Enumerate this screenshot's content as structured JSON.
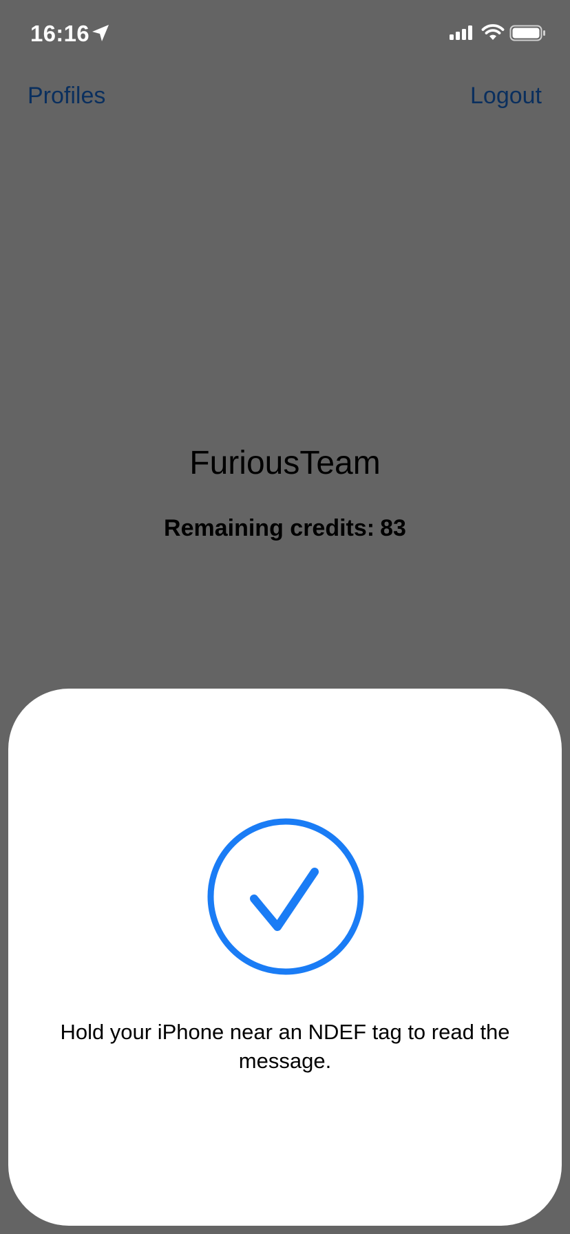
{
  "status_bar": {
    "time": "16:16",
    "icons": [
      "location-arrow-icon",
      "cellular-signal-icon",
      "wifi-icon",
      "battery-icon"
    ]
  },
  "nav": {
    "left_label": "Profiles",
    "right_label": "Logout"
  },
  "main": {
    "team_name": "FuriousTeam",
    "credits_label": "Remaining credits:",
    "credits_value": "83"
  },
  "nfc_sheet": {
    "icon": "checkmark-circle-icon",
    "message": "Hold your iPhone near an NDEF tag to read the message."
  },
  "colors": {
    "background": "#646464",
    "nav_link": "#0a2f5e",
    "accent": "#1a7cf5",
    "sheet": "#ffffff"
  }
}
